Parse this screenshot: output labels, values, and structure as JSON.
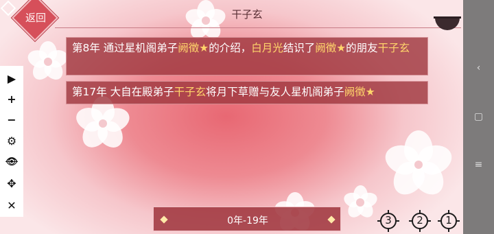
{
  "header": {
    "back_label": "返回",
    "title": "干子玄"
  },
  "events": [
    {
      "segments": [
        {
          "text": "第8年 通过星机阁弟子",
          "highlight": false
        },
        {
          "text": "阙徵★",
          "highlight": true
        },
        {
          "text": "的介绍，",
          "highlight": false
        },
        {
          "text": "白月光",
          "highlight": true
        },
        {
          "text": "结识了",
          "highlight": false
        },
        {
          "text": "阙徵★",
          "highlight": true
        },
        {
          "text": "的朋友",
          "highlight": false
        },
        {
          "text": "干子玄",
          "highlight": true
        }
      ]
    },
    {
      "segments": [
        {
          "text": "第17年 大自在殿弟子",
          "highlight": false
        },
        {
          "text": "干子玄",
          "highlight": true
        },
        {
          "text": "将月下草赠与友人星机阁弟子",
          "highlight": false
        },
        {
          "text": "阙徵★",
          "highlight": true
        }
      ]
    }
  ],
  "toolbar": {
    "tools": [
      {
        "name": "play-icon",
        "glyph": "▶"
      },
      {
        "name": "zoom-in-icon",
        "glyph": "+"
      },
      {
        "name": "zoom-out-icon",
        "glyph": "−"
      },
      {
        "name": "gear-icon",
        "glyph": "⚙"
      },
      {
        "name": "eye-off-icon",
        "glyph": "👁"
      },
      {
        "name": "move-icon",
        "glyph": "✥"
      },
      {
        "name": "close-icon",
        "glyph": "✕"
      }
    ]
  },
  "system_nav": {
    "back_glyph": "‹",
    "home_glyph": "▢",
    "menu_glyph": "≡"
  },
  "timeline": {
    "label": "0年-19年"
  },
  "slots": [
    {
      "number": "3"
    },
    {
      "number": "2"
    },
    {
      "number": "1"
    }
  ],
  "colors": {
    "highlight": "#ffd56b",
    "event_bg": "#a03840",
    "accent": "#d64f5a"
  }
}
